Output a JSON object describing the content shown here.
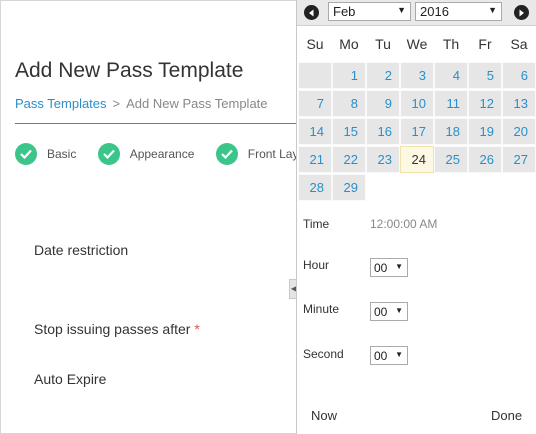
{
  "page": {
    "title": "Add New Pass Template",
    "breadcrumb": {
      "link": "Pass Templates",
      "separator": ">",
      "current": "Add New Pass Template"
    },
    "steps": [
      {
        "label": "Basic"
      },
      {
        "label": "Appearance"
      },
      {
        "label": "Front Layou"
      }
    ],
    "fields": {
      "date_restriction": "Date restriction",
      "stop_issuing": "Stop issuing passes after",
      "required_mark": "*",
      "auto_expire": "Auto Expire"
    },
    "collapse_glyph": "◀"
  },
  "picker": {
    "month": "Feb",
    "year": "2016",
    "weekdays": [
      "Su",
      "Mo",
      "Tu",
      "We",
      "Th",
      "Fr",
      "Sa"
    ],
    "weeks": [
      [
        "",
        "1",
        "2",
        "3",
        "4",
        "5",
        "6"
      ],
      [
        "7",
        "8",
        "9",
        "10",
        "11",
        "12",
        "13"
      ],
      [
        "14",
        "15",
        "16",
        "17",
        "18",
        "19",
        "20"
      ],
      [
        "21",
        "22",
        "23",
        "24",
        "25",
        "26",
        "27"
      ],
      [
        "28",
        "29"
      ]
    ],
    "today": "24",
    "time_label": "Time",
    "time_value": "12:00:00 AM",
    "hour_label": "Hour",
    "hour_value": "00",
    "minute_label": "Minute",
    "minute_value": "00",
    "second_label": "Second",
    "second_value": "00",
    "now_label": "Now",
    "done_label": "Done",
    "colors": {
      "accent": "#2a8fc9",
      "check": "#3cc58a",
      "today_bg": "#fcf8e3"
    }
  }
}
